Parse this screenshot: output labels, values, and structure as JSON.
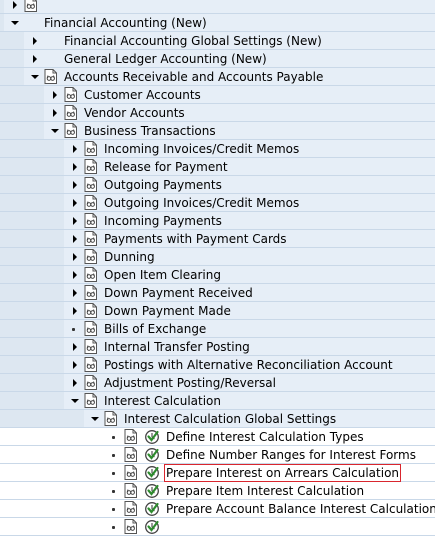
{
  "tree": {
    "nodes": [
      {
        "label": "",
        "level": 1,
        "state": "collapsed",
        "doc": true,
        "act": false
      },
      {
        "label": "Financial Accounting (New)",
        "level": 1,
        "state": "expanded",
        "doc": false,
        "act": false
      },
      {
        "label": "Financial Accounting Global Settings (New)",
        "level": 2,
        "state": "collapsed",
        "doc": false,
        "act": false
      },
      {
        "label": "General Ledger Accounting (New)",
        "level": 2,
        "state": "collapsed",
        "doc": false,
        "act": false
      },
      {
        "label": "Accounts Receivable and Accounts Payable",
        "level": 2,
        "state": "expanded",
        "doc": true,
        "act": false
      },
      {
        "label": "Customer Accounts",
        "level": 3,
        "state": "collapsed",
        "doc": true,
        "act": false
      },
      {
        "label": "Vendor Accounts",
        "level": 3,
        "state": "collapsed",
        "doc": true,
        "act": false
      },
      {
        "label": "Business Transactions",
        "level": 3,
        "state": "expanded",
        "doc": true,
        "act": false
      },
      {
        "label": "Incoming Invoices/Credit Memos",
        "level": 4,
        "state": "collapsed",
        "doc": true,
        "act": false
      },
      {
        "label": "Release for Payment",
        "level": 4,
        "state": "collapsed",
        "doc": true,
        "act": false
      },
      {
        "label": "Outgoing Payments",
        "level": 4,
        "state": "collapsed",
        "doc": true,
        "act": false
      },
      {
        "label": "Outgoing Invoices/Credit Memos",
        "level": 4,
        "state": "collapsed",
        "doc": true,
        "act": false
      },
      {
        "label": "Incoming Payments",
        "level": 4,
        "state": "collapsed",
        "doc": true,
        "act": false
      },
      {
        "label": "Payments with Payment Cards",
        "level": 4,
        "state": "collapsed",
        "doc": true,
        "act": false
      },
      {
        "label": "Dunning",
        "level": 4,
        "state": "collapsed",
        "doc": true,
        "act": false
      },
      {
        "label": "Open Item Clearing",
        "level": 4,
        "state": "collapsed",
        "doc": true,
        "act": false
      },
      {
        "label": "Down Payment Received",
        "level": 4,
        "state": "collapsed",
        "doc": true,
        "act": false
      },
      {
        "label": "Down Payment Made",
        "level": 4,
        "state": "collapsed",
        "doc": true,
        "act": false
      },
      {
        "label": "Bills of Exchange",
        "level": 4,
        "state": "leaf",
        "doc": true,
        "act": false
      },
      {
        "label": "Internal Transfer Posting",
        "level": 4,
        "state": "collapsed",
        "doc": true,
        "act": false
      },
      {
        "label": "Postings with Alternative Reconciliation Account",
        "level": 4,
        "state": "collapsed",
        "doc": true,
        "act": false
      },
      {
        "label": "Adjustment Posting/Reversal",
        "level": 4,
        "state": "collapsed",
        "doc": true,
        "act": false
      },
      {
        "label": "Interest Calculation",
        "level": 4,
        "state": "expanded",
        "doc": true,
        "act": false
      },
      {
        "label": "Interest Calculation Global Settings",
        "level": 5,
        "state": "expanded",
        "doc": true,
        "act": false
      },
      {
        "label": "Define Interest Calculation Types",
        "level": 6,
        "state": "leaf",
        "doc": true,
        "act": true
      },
      {
        "label": "Define Number Ranges for Interest Forms",
        "level": 6,
        "state": "leaf",
        "doc": true,
        "act": true
      },
      {
        "label": "Prepare Interest on Arrears Calculation",
        "level": 6,
        "state": "leaf",
        "doc": true,
        "act": true,
        "selected": true
      },
      {
        "label": "Prepare Item Interest Calculation",
        "level": 6,
        "state": "leaf",
        "doc": true,
        "act": true
      },
      {
        "label": "Prepare Account Balance Interest Calculation",
        "level": 6,
        "state": "leaf",
        "doc": true,
        "act": true
      },
      {
        "label": "",
        "level": 6,
        "state": "leaf",
        "doc": true,
        "act": true
      }
    ]
  },
  "colors": {
    "selection_outline": "#d9262e",
    "row_shade": "#e6eef7",
    "guide": "#c9d8e8",
    "activity_green": "#2e8b2e"
  },
  "icons": {
    "doc": "documentation-icon",
    "activity": "execute-clock-icon"
  }
}
